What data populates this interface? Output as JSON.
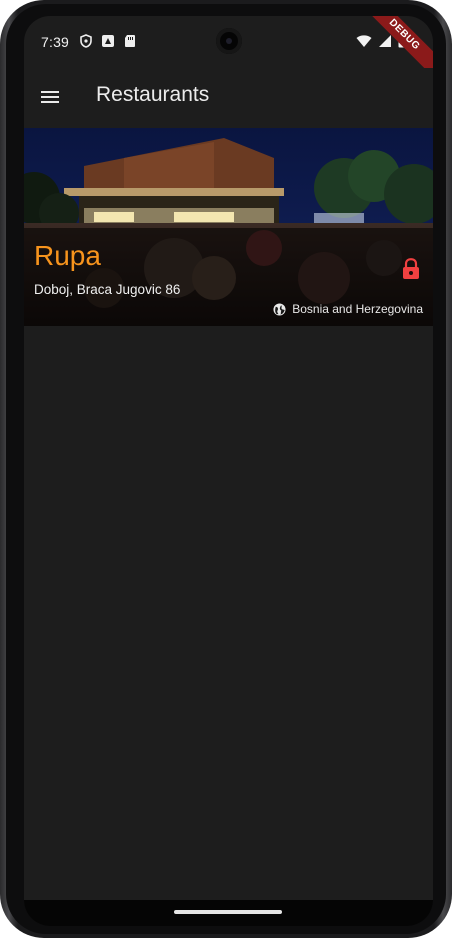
{
  "status_bar": {
    "time": "7:39",
    "left_icons": [
      "shield-icon",
      "photo-icon",
      "sd-card-icon"
    ],
    "right_icons": [
      "wifi-icon",
      "cell-signal-icon",
      "battery-icon"
    ],
    "debug_banner": "DEBUG"
  },
  "app_bar": {
    "menu_icon": "menu-icon",
    "title": "Restaurants"
  },
  "restaurants": [
    {
      "name": "Rupa",
      "address": "Doboj, Braca Jugovic 86",
      "country": "Bosnia and Herzegovina",
      "lock_icon": "lock-icon",
      "globe_icon": "globe-icon"
    }
  ],
  "colors": {
    "background": "#1d1d1d",
    "name_accent": "#f7941d",
    "lock": "#e53935",
    "debug_ribbon": "#8b1a1a"
  }
}
